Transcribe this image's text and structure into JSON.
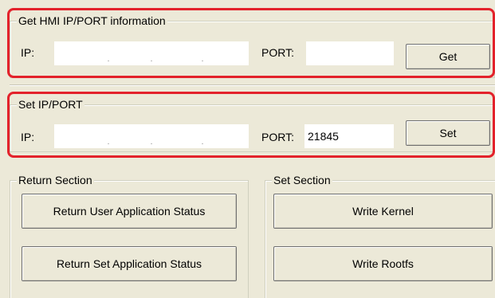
{
  "get_group": {
    "title": "Get HMI IP/PORT information",
    "ip_label": "IP:",
    "ip_value": [
      "",
      "",
      "",
      ""
    ],
    "ip_dot": ".",
    "port_label": "PORT:",
    "port_value": "",
    "button_label": "Get"
  },
  "set_group": {
    "title": "Set IP/PORT",
    "ip_label": "IP:",
    "ip_value": [
      "",
      "",
      "",
      ""
    ],
    "ip_dot": ".",
    "port_label": "PORT:",
    "port_value": "21845",
    "button_label": "Set"
  },
  "return_section": {
    "title": "Return Section",
    "buttons": [
      "Return User Application Status",
      "Return Set Application Status"
    ]
  },
  "set_section": {
    "title": "Set Section",
    "buttons": [
      "Write Kernel",
      "Write Rootfs"
    ]
  },
  "colors": {
    "window_bg": "#ece9d8",
    "highlight": "#e3222b",
    "field_bg": "#ffffff"
  }
}
